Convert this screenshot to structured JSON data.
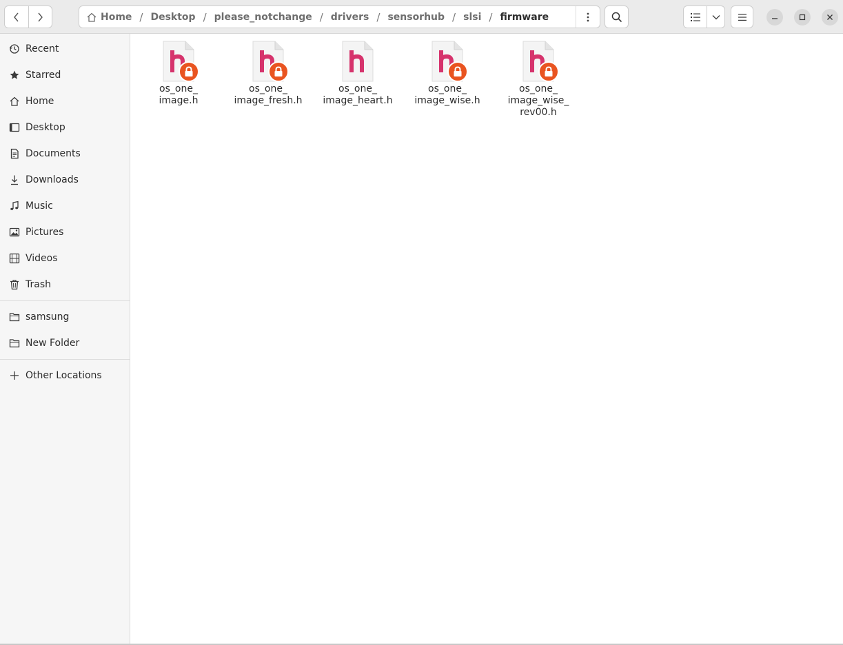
{
  "header": {
    "back_icon": "chevron-left-icon",
    "forward_icon": "chevron-right-icon",
    "path": [
      {
        "label": "Home",
        "icon": "home-icon"
      },
      {
        "label": "Desktop"
      },
      {
        "label": "please_notchange"
      },
      {
        "label": "drivers"
      },
      {
        "label": "sensorhub"
      },
      {
        "label": "slsi"
      },
      {
        "label": "firmware",
        "current": true
      }
    ],
    "path_separator": "/",
    "window_controls": [
      "minimize-icon",
      "maximize-icon",
      "close-icon"
    ]
  },
  "sidebar": {
    "items": [
      {
        "label": "Recent",
        "icon": "clock-icon"
      },
      {
        "label": "Starred",
        "icon": "star-icon"
      },
      {
        "label": "Home",
        "icon": "home-icon"
      },
      {
        "label": "Desktop",
        "icon": "desktop-icon"
      },
      {
        "label": "Documents",
        "icon": "document-icon"
      },
      {
        "label": "Downloads",
        "icon": "download-icon"
      },
      {
        "label": "Music",
        "icon": "music-icon"
      },
      {
        "label": "Pictures",
        "icon": "picture-icon"
      },
      {
        "label": "Videos",
        "icon": "film-icon"
      },
      {
        "label": "Trash",
        "icon": "trash-icon"
      }
    ],
    "bookmarks": [
      {
        "label": "samsung",
        "icon": "folder-icon"
      },
      {
        "label": "New Folder",
        "icon": "folder-icon"
      }
    ],
    "other": {
      "label": "Other Locations",
      "icon": "plus-icon"
    }
  },
  "files": [
    {
      "name": "os_one_ image.h",
      "lines": [
        "os_one_",
        "image.h"
      ],
      "locked": true
    },
    {
      "name": "os_one_ image_fresh.h",
      "lines": [
        "os_one_",
        "image_fresh.h"
      ],
      "locked": true
    },
    {
      "name": "os_one_ image_heart.h",
      "lines": [
        "os_one_",
        "image_heart.h"
      ],
      "locked": false
    },
    {
      "name": "os_one_ image_wise.h",
      "lines": [
        "os_one_",
        "image_wise.h"
      ],
      "locked": true
    },
    {
      "name": "os_one_ image_wise_ rev00.h",
      "lines": [
        "os_one_",
        "image_wise_",
        "rev00.h"
      ],
      "locked": true
    }
  ],
  "colors": {
    "accent": "#e95420",
    "header_glyph": "#d6336c",
    "file_paper": "#f4f4f4"
  }
}
